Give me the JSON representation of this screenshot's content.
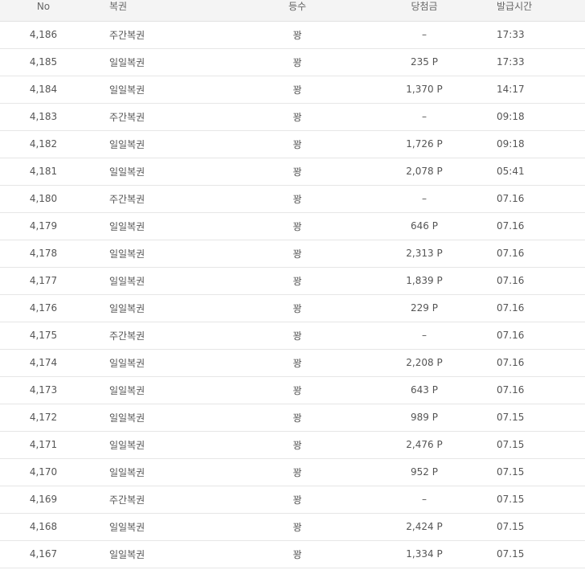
{
  "headers": {
    "no": "No",
    "type": "복권",
    "rank": "등수",
    "prize": "당첨금",
    "time": "발급시간"
  },
  "rows": [
    {
      "no": "4,186",
      "type": "주간복권",
      "rank": "꽝",
      "prize": "–",
      "time": "17:33"
    },
    {
      "no": "4,185",
      "type": "일일복권",
      "rank": "꽝",
      "prize": "235 P",
      "time": "17:33"
    },
    {
      "no": "4,184",
      "type": "일일복권",
      "rank": "꽝",
      "prize": "1,370 P",
      "time": "14:17"
    },
    {
      "no": "4,183",
      "type": "주간복권",
      "rank": "꽝",
      "prize": "–",
      "time": "09:18"
    },
    {
      "no": "4,182",
      "type": "일일복권",
      "rank": "꽝",
      "prize": "1,726 P",
      "time": "09:18"
    },
    {
      "no": "4,181",
      "type": "일일복권",
      "rank": "꽝",
      "prize": "2,078 P",
      "time": "05:41"
    },
    {
      "no": "4,180",
      "type": "주간복권",
      "rank": "꽝",
      "prize": "–",
      "time": "07.16"
    },
    {
      "no": "4,179",
      "type": "일일복권",
      "rank": "꽝",
      "prize": "646 P",
      "time": "07.16"
    },
    {
      "no": "4,178",
      "type": "일일복권",
      "rank": "꽝",
      "prize": "2,313 P",
      "time": "07.16"
    },
    {
      "no": "4,177",
      "type": "일일복권",
      "rank": "꽝",
      "prize": "1,839 P",
      "time": "07.16"
    },
    {
      "no": "4,176",
      "type": "일일복권",
      "rank": "꽝",
      "prize": "229 P",
      "time": "07.16"
    },
    {
      "no": "4,175",
      "type": "주간복권",
      "rank": "꽝",
      "prize": "–",
      "time": "07.16"
    },
    {
      "no": "4,174",
      "type": "일일복권",
      "rank": "꽝",
      "prize": "2,208 P",
      "time": "07.16"
    },
    {
      "no": "4,173",
      "type": "일일복권",
      "rank": "꽝",
      "prize": "643 P",
      "time": "07.16"
    },
    {
      "no": "4,172",
      "type": "일일복권",
      "rank": "꽝",
      "prize": "989 P",
      "time": "07.15"
    },
    {
      "no": "4,171",
      "type": "일일복권",
      "rank": "꽝",
      "prize": "2,476 P",
      "time": "07.15"
    },
    {
      "no": "4,170",
      "type": "일일복권",
      "rank": "꽝",
      "prize": "952 P",
      "time": "07.15"
    },
    {
      "no": "4,169",
      "type": "주간복권",
      "rank": "꽝",
      "prize": "–",
      "time": "07.15"
    },
    {
      "no": "4,168",
      "type": "일일복권",
      "rank": "꽝",
      "prize": "2,424 P",
      "time": "07.15"
    },
    {
      "no": "4,167",
      "type": "일일복권",
      "rank": "꽝",
      "prize": "1,334 P",
      "time": "07.15"
    }
  ]
}
